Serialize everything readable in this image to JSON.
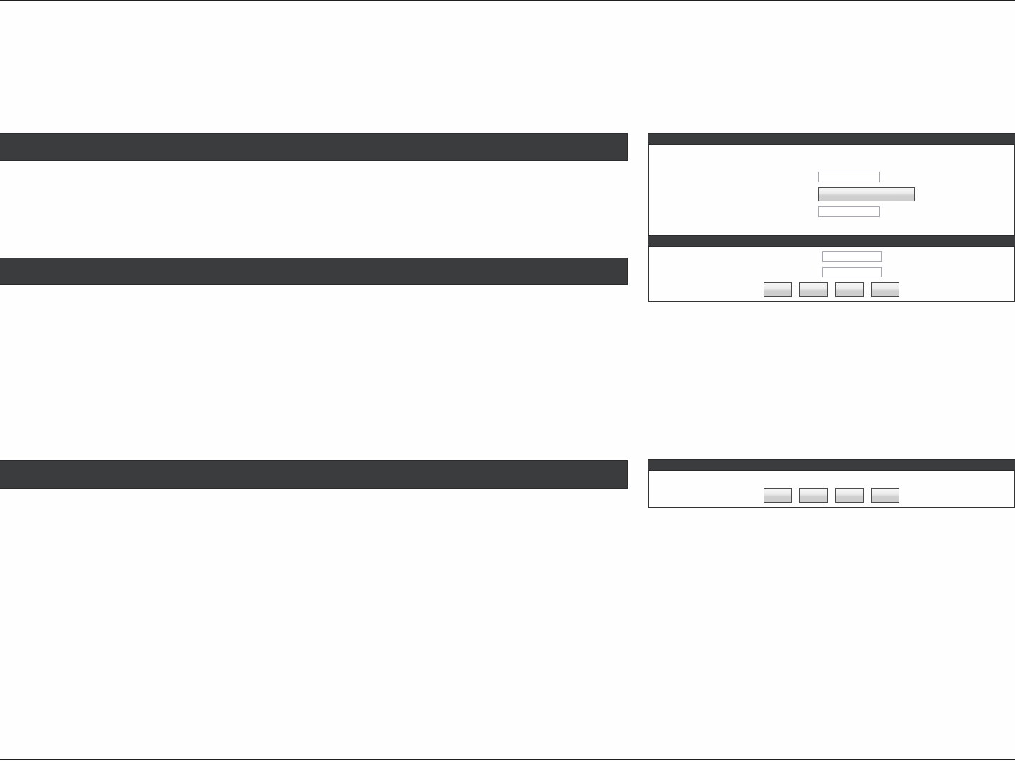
{
  "sections": [
    {
      "kind": "header_bar"
    },
    {
      "kind": "header_bar"
    },
    {
      "kind": "header_bar"
    }
  ],
  "panels": [
    {
      "groups": [
        {
          "controls": [
            {
              "kind": "field"
            },
            {
              "kind": "wide_button"
            },
            {
              "kind": "field"
            }
          ]
        },
        {
          "controls": [
            {
              "kind": "field"
            },
            {
              "kind": "field"
            },
            {
              "kind": "button_row",
              "buttons": [
                {
                  "kind": "button"
                },
                {
                  "kind": "button"
                },
                {
                  "kind": "button"
                },
                {
                  "kind": "button"
                }
              ]
            }
          ]
        }
      ]
    },
    {
      "groups": [
        {
          "controls": [
            {
              "kind": "button_row",
              "buttons": [
                {
                  "kind": "button"
                },
                {
                  "kind": "button"
                },
                {
                  "kind": "button"
                },
                {
                  "kind": "button"
                }
              ]
            }
          ]
        }
      ]
    }
  ]
}
